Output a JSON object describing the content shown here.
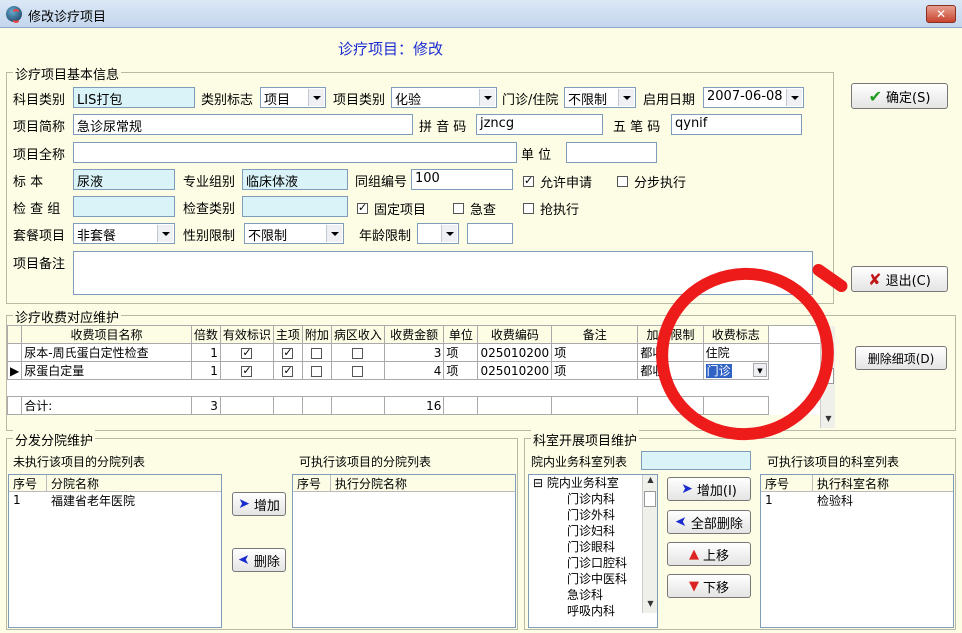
{
  "window": {
    "title": "修改诊疗项目",
    "close_label": "✕"
  },
  "header": {
    "text": "诊疗项目：修改"
  },
  "basic_info": {
    "legend": "诊疗项目基本信息",
    "labels": {
      "category": "科目类别",
      "category_flag": "类别标志",
      "item_type": "项目类别",
      "clinic_inpatient": "门诊/住院",
      "start_date": "启用日期",
      "short_name": "项目简称",
      "pinyin": "拼 音 码",
      "wubi": "五 笔 码",
      "full_name": "项目全称",
      "unit": "单  位",
      "specimen": "标    本",
      "specialty_group": "专业组别",
      "group_number": "同组编号",
      "check_group": "检 查 组",
      "check_type": "检查类别",
      "package": "套餐项目",
      "gender_limit": "性别限制",
      "age_limit": "年龄限制",
      "remarks": "项目备注"
    },
    "values": {
      "category": "LIS打包",
      "category_flag": "项目",
      "item_type": "化验",
      "clinic_inpatient": "不限制",
      "start_date": "2007-06-08",
      "short_name": "急诊尿常规",
      "pinyin": "jzncg",
      "wubi": "qynif",
      "full_name": "",
      "unit": "",
      "specimen": "尿液",
      "specialty_group": "临床体液",
      "group_number": "100",
      "check_group": "",
      "check_type": "",
      "package": "非套餐",
      "gender_limit": "不限制",
      "age_limit": "",
      "age_value": "",
      "remarks": ""
    },
    "checkboxes": {
      "allow_apply": {
        "label": "允许申请",
        "checked": true
      },
      "async_exec": {
        "label": "分步执行",
        "checked": false
      },
      "fixed_item": {
        "label": "固定项目",
        "checked": true
      },
      "urgent": {
        "label": "急查",
        "checked": false
      },
      "rush_exec": {
        "label": "抢执行",
        "checked": false
      }
    }
  },
  "buttons": {
    "confirm": "确定(S)",
    "exit": "退出(C)",
    "delete_detail": "删除细项(D)"
  },
  "fee_section": {
    "legend": "诊疗收费对应维护",
    "columns": [
      "收费项目名称",
      "倍数",
      "有效标识",
      "主项",
      "附加",
      "病区收入",
      "收费金额",
      "单位",
      "收费编码",
      "备注",
      "加收限制",
      "收费标志"
    ],
    "rows": [
      {
        "name": "尿本-周氏蛋白定性检查",
        "multiple": "1",
        "valid": true,
        "main": true,
        "extra": false,
        "ward": false,
        "amount": "3",
        "unit": "项",
        "code": "025010200",
        "remark": "项",
        "limit": "都收",
        "flag": "住院"
      },
      {
        "name": "尿蛋白定量",
        "multiple": "1",
        "valid": true,
        "main": true,
        "extra": false,
        "ward": false,
        "amount": "4",
        "unit": "项",
        "code": "025010200",
        "remark": "项",
        "limit": "都收",
        "flag": "门诊"
      }
    ],
    "total_label": "合计:",
    "total_multiple": "3",
    "total_amount": "16"
  },
  "branch_section": {
    "legend": "分发分院维护",
    "left_title": "未执行该项目的分院列表",
    "right_title": "可执行该项目的分院列表",
    "left_columns": [
      "序号",
      "分院名称"
    ],
    "left_rows": [
      {
        "no": "1",
        "name": "福建省老年医院"
      }
    ],
    "right_columns": [
      "序号",
      "执行分院名称"
    ],
    "add_label": "增加",
    "delete_label": "删除"
  },
  "dept_section": {
    "legend": "科室开展项目维护",
    "left_title": "院内业务科室列表",
    "right_title": "可执行该项目的科室列表",
    "search_value": "",
    "tree_root": "院内业务科室",
    "tree_items": [
      "门诊内科",
      "门诊外科",
      "门诊妇科",
      "门诊眼科",
      "门诊口腔科",
      "门诊中医科",
      "急诊科",
      "呼吸内科"
    ],
    "buttons": {
      "add": "增加(I)",
      "delete_all": "全部删除",
      "up": "上移",
      "down": "下移"
    },
    "right_columns": [
      "序号",
      "执行科室名称"
    ],
    "right_rows": [
      {
        "no": "1",
        "name": "检验科"
      }
    ]
  },
  "colors": {
    "background": "#fdfde6",
    "accent": "#1a2bd0",
    "annotation": "#ee1b1b",
    "highlight_field": "#d9f3f8"
  }
}
